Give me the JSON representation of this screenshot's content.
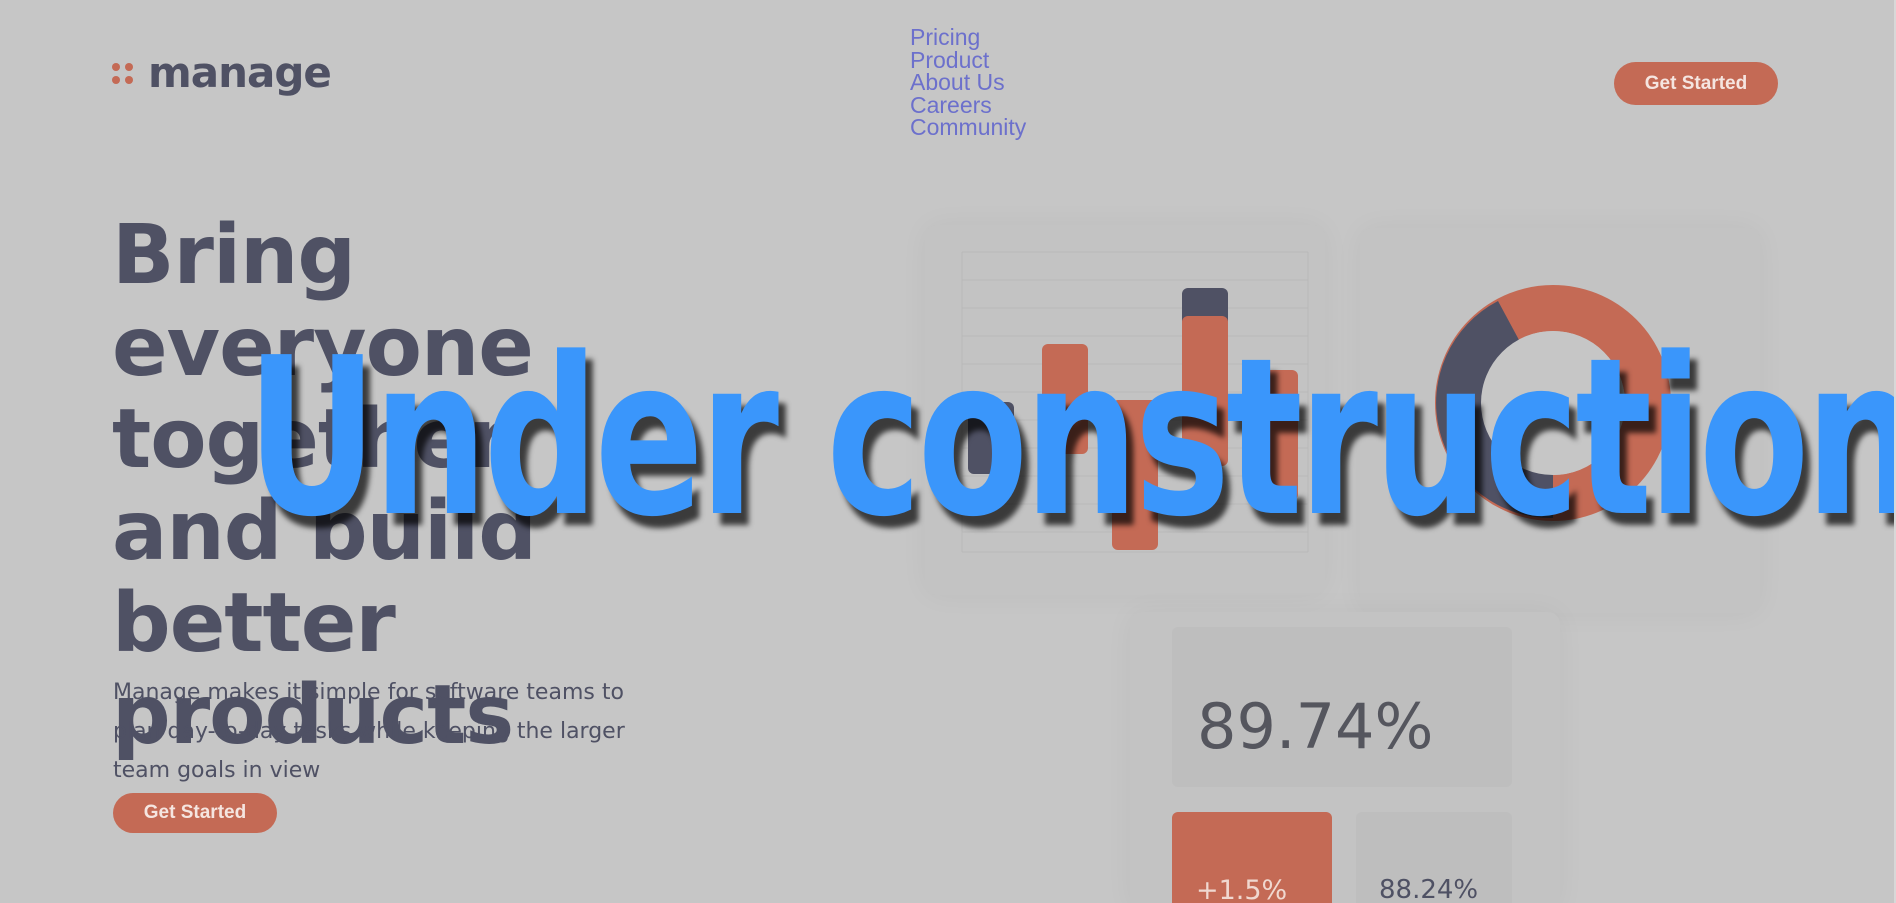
{
  "header": {
    "logo_text": "manage",
    "nav": [
      "Pricing",
      "Product",
      "About Us",
      "Careers",
      "Community"
    ],
    "cta_label": "Get Started"
  },
  "hero": {
    "title": "Bring everyone together and build better products",
    "description": "Manage makes it simple for software teams to plan day-to-day tasks while keeping the larger team goals in view",
    "cta_label": "Get Started"
  },
  "dashboard": {
    "stat_main": "89.74%",
    "stat_change": "+1.5%",
    "stat_secondary": "88.24%"
  },
  "overlay": {
    "text": "Under construction"
  },
  "colors": {
    "background": "#c6c6c6",
    "brand_orange": "#c46a55",
    "brand_navy": "#4f5164",
    "nav_link": "#6c70cc",
    "overlay_blue": "#3a96fb"
  }
}
